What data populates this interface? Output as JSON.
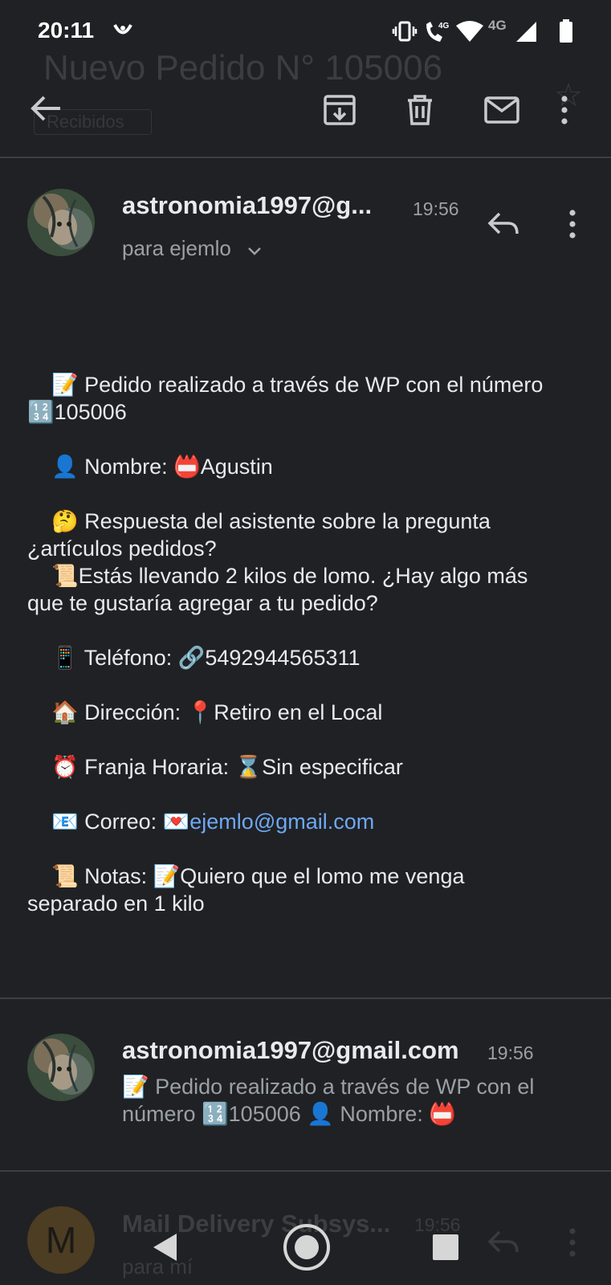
{
  "status_bar": {
    "time": "20:11",
    "network_4g_call": "4G",
    "network_4g": "4G"
  },
  "background_header": {
    "subject": "Nuevo Pedido N° 105006",
    "label": "Recibidos"
  },
  "toolbar": {
    "icons": [
      "back-arrow-icon",
      "archive-icon",
      "delete-icon",
      "mark-unread-icon",
      "more-vert-icon"
    ]
  },
  "message": {
    "sender": "astronomia1997@g...",
    "time": "19:56",
    "to": "para ejemlo",
    "body": {
      "line1": "📝 Pedido realizado a través de WP con el número",
      "line1b": "🔢105006",
      "name": "👤 Nombre: 📛Agustin",
      "question": "🤔 Respuesta del asistente sobre la pregunta",
      "question_b": "¿artículos pedidos?",
      "answer": "📜Estás llevando 2 kilos de lomo. ¿Hay algo más",
      "answer_b": "que te gustaría agregar a tu pedido?",
      "phone": "📱 Teléfono: 🔗5492944565311",
      "address": "🏠 Dirección: 📍Retiro en el Local",
      "schedule": "⏰ Franja Horaria: ⌛Sin especificar",
      "email_label": "📧 Correo: 💌",
      "email_link": "ejemlo@gmail.com",
      "notes": "📜 Notas: 📝Quiero que el lomo me venga",
      "notes_b": "separado en 1 kilo"
    }
  },
  "collapsed_message": {
    "sender": "astronomia1997@gmail.com",
    "time": "19:56",
    "snippet": "📝 Pedido realizado a través de WP con el número 🔢105006 👤 Nombre: 📛"
  },
  "ghost_message": {
    "avatar_letter": "M",
    "sender": "Mail Delivery Subsys...",
    "time": "19:56",
    "to": "para mí"
  },
  "colors": {
    "background": "#202124",
    "link": "#6ea8f5",
    "secondary_text": "#9aa0a6"
  }
}
